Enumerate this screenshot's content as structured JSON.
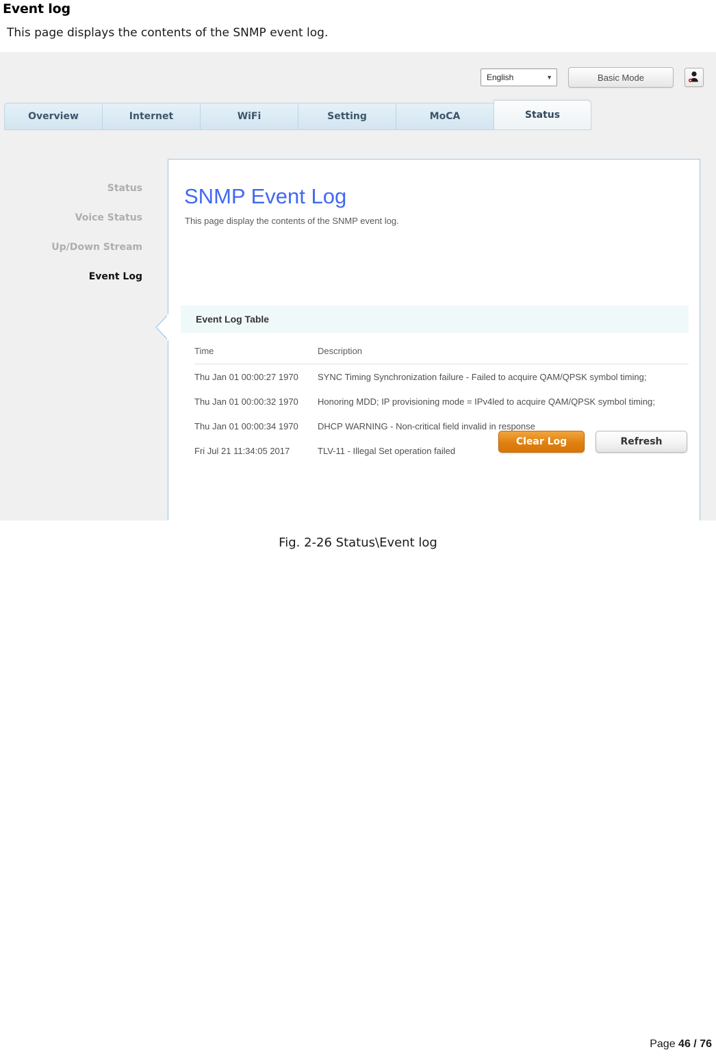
{
  "document": {
    "heading": "Event log",
    "intro": "This page displays the contents of the SNMP event log.",
    "caption": "Fig. 2-26 Status\\Event log",
    "footer": {
      "label": "Page",
      "current": "46",
      "separator": "/",
      "total": "76"
    }
  },
  "screenshot": {
    "topbar": {
      "language_value": "English",
      "language_caret": "▼",
      "basic_mode_label": "Basic Mode",
      "user_icon": "user-account-icon"
    },
    "tabs": [
      {
        "label": "Overview",
        "active": false
      },
      {
        "label": "Internet",
        "active": false
      },
      {
        "label": "WiFi",
        "active": false
      },
      {
        "label": "Setting",
        "active": false
      },
      {
        "label": "MoCA",
        "active": false
      },
      {
        "label": "Status",
        "active": true
      }
    ],
    "sidebar": [
      {
        "label": "Status",
        "active": false
      },
      {
        "label": "Voice Status",
        "active": false
      },
      {
        "label": "Up/Down Stream",
        "active": false
      },
      {
        "label": "Event Log",
        "active": true
      }
    ],
    "card": {
      "title": "SNMP Event Log",
      "subtitle": "This page display the contents of the SNMP event log.",
      "section_header": "Event Log Table",
      "table": {
        "columns": [
          "Time",
          "Description"
        ],
        "rows": [
          {
            "time": "Thu Jan 01 00:00:27 1970",
            "description": "SYNC Timing Synchronization failure - Failed to acquire QAM/QPSK symbol timing;"
          },
          {
            "time": "Thu Jan 01 00:00:32 1970",
            "description": "Honoring MDD; IP provisioning mode = IPv4led to acquire QAM/QPSK symbol timing;"
          },
          {
            "time": "Thu Jan 01 00:00:34 1970",
            "description": "DHCP WARNING - Non-critical field invalid in response"
          },
          {
            "time": "Fri Jul 21 11:34:05 2017",
            "description": "TLV-11 - Illegal Set operation failed"
          }
        ]
      },
      "buttons": {
        "clear_log": "Clear Log",
        "refresh": "Refresh"
      }
    },
    "colors": {
      "title_blue": "#4169f0",
      "clear_log_orange": "#e08010",
      "card_border": "#9ac9e3",
      "panel_bg": "#f0f0f0",
      "section_band": "#f0f9f9",
      "tab_blue": "#d3e5f1"
    }
  }
}
